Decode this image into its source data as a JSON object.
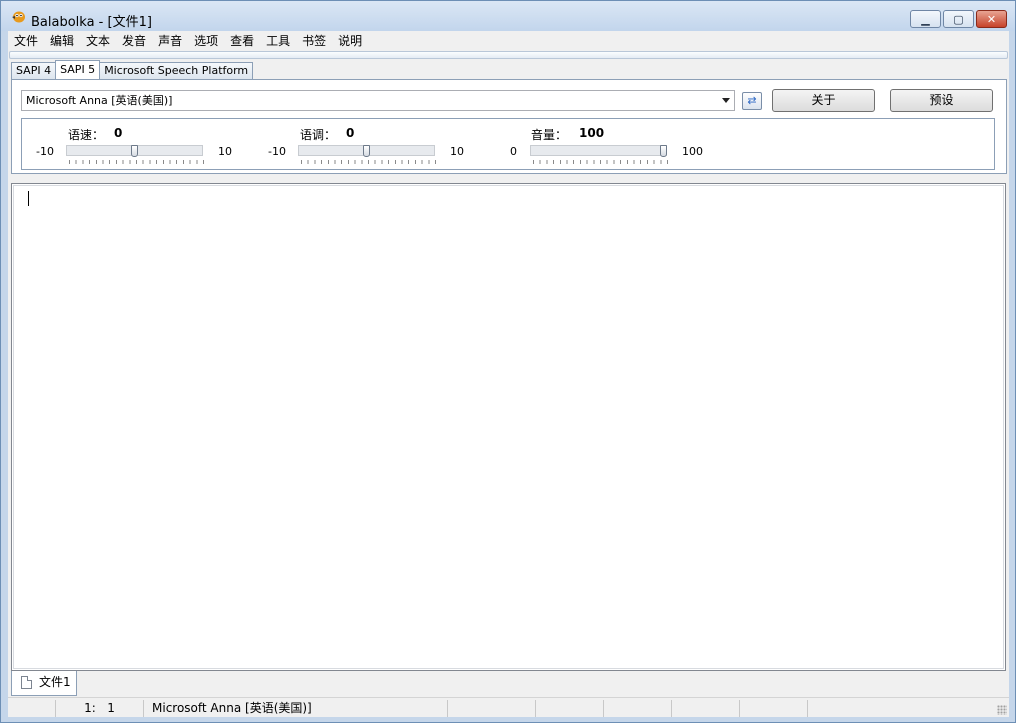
{
  "window": {
    "title": "Balabolka - [文件1]",
    "minimize_icon": "minimize-icon",
    "maximize_icon": "maximize-icon",
    "close_icon": "close-icon"
  },
  "menu": [
    "文件",
    "编辑",
    "文本",
    "发音",
    "声音",
    "选项",
    "查看",
    "工具",
    "书签",
    "说明"
  ],
  "engine_tabs": [
    {
      "label": "SAPI 4",
      "active": false
    },
    {
      "label": "SAPI 5",
      "active": true
    },
    {
      "label": "Microsoft Speech Platform",
      "active": false
    }
  ],
  "voice": {
    "selected": "Microsoft Anna [英语(美国)]",
    "about_label": "关于",
    "preset_label": "预设"
  },
  "sliders": {
    "rate": {
      "label": "语速：",
      "value": "0",
      "min": "-10",
      "max": "10"
    },
    "pitch": {
      "label": "语调：",
      "value": "0",
      "min": "-10",
      "max": "10"
    },
    "volume": {
      "label": "音量：",
      "value": "100",
      "min": "0",
      "max": "100"
    }
  },
  "editor": {
    "text": ""
  },
  "document_tabs": [
    {
      "label": "文件1"
    }
  ],
  "status": {
    "position": "1:   1",
    "voice": "Microsoft Anna [英语(美国)]"
  },
  "colors": {
    "title_bar": "#c5d6ea",
    "close_button": "#c7432a",
    "window_background": "#f0f0f0"
  }
}
